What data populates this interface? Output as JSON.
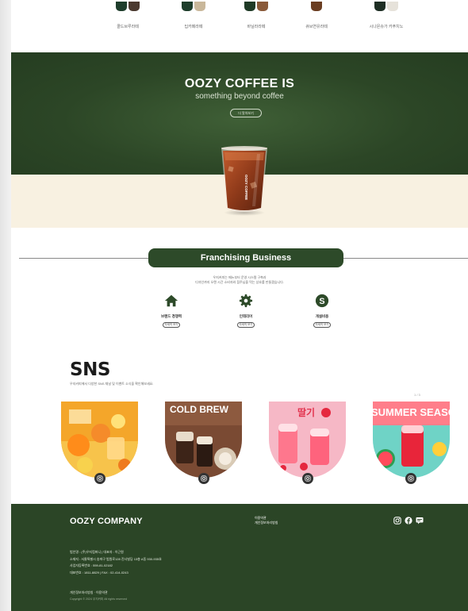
{
  "products": [
    {
      "name": "콜드브루라떼",
      "cup_colors": [
        "#1e3d2b",
        "#4b3a30"
      ]
    },
    {
      "name": "딥카페라떼",
      "cup_colors": [
        "#1e3d2b",
        "#c9b79a"
      ]
    },
    {
      "name": "바닐라라떼",
      "cup_colors": [
        "#1f3a26",
        "#8a5a3a"
      ]
    },
    {
      "name": "큐브연유라떼",
      "cup_colors": [
        "#6b3e22"
      ]
    },
    {
      "name": "시나몬슈가 카푸치노",
      "cup_colors": [
        "#1e2e24",
        "#e6e2da"
      ]
    }
  ],
  "hero": {
    "title": "OOZY COFFEE IS",
    "subtitle": "something beyond coffee",
    "button_label": "더 알아보기",
    "cup_text": "OOZY COFFEE"
  },
  "franchising": {
    "title": "Franchising Business",
    "desc_line1": "우지커피는 메뉴부터 운영 시스템 구축과",
    "desc_line2": "디자인까지 오랜 시간 소비자와 점주님을 먹는 상호를 만들겠습니다.",
    "items": [
      {
        "label": "브랜드 경쟁력",
        "more": "자세히 보기",
        "icon": "home-icon"
      },
      {
        "label": "인테리어",
        "more": "자세히 보기",
        "icon": "gear-icon"
      },
      {
        "label": "개설비용",
        "more": "자세히 보기",
        "icon": "dollar-icon"
      }
    ]
  },
  "sns": {
    "title": "SNS",
    "desc": "우지커피에서 다양한 SNS 채널 및 이벤트 소식을 확인해보세요.",
    "page_indicator": "1 / 3",
    "banner2_text": "COLD BREW",
    "banner3_text": "딸기",
    "banner4_text": "SUMMER SEASON"
  },
  "footer": {
    "brand": "OOZY COMPANY",
    "link1": "이용약관",
    "link2": "개인정보처리방침",
    "info_lines": [
      "법인명 : (주)우지컴퍼니 | 대표자 : 이근원",
      "소재지 : 서울특별시 송파구 법원로128 진사빌딩 13층 A동 930-935호",
      "사업자등록번호 : 559-81-02182",
      "대표번호 : 1811-8829 | FAX : 02-414-0243"
    ],
    "policy": "개인정보처리방침 · 이용약관",
    "copyright": "Copyright © 2024 우지커피 All rights reserved"
  },
  "colors": {
    "brand_green": "#2d4a29",
    "cream": "#f8f1e1"
  }
}
